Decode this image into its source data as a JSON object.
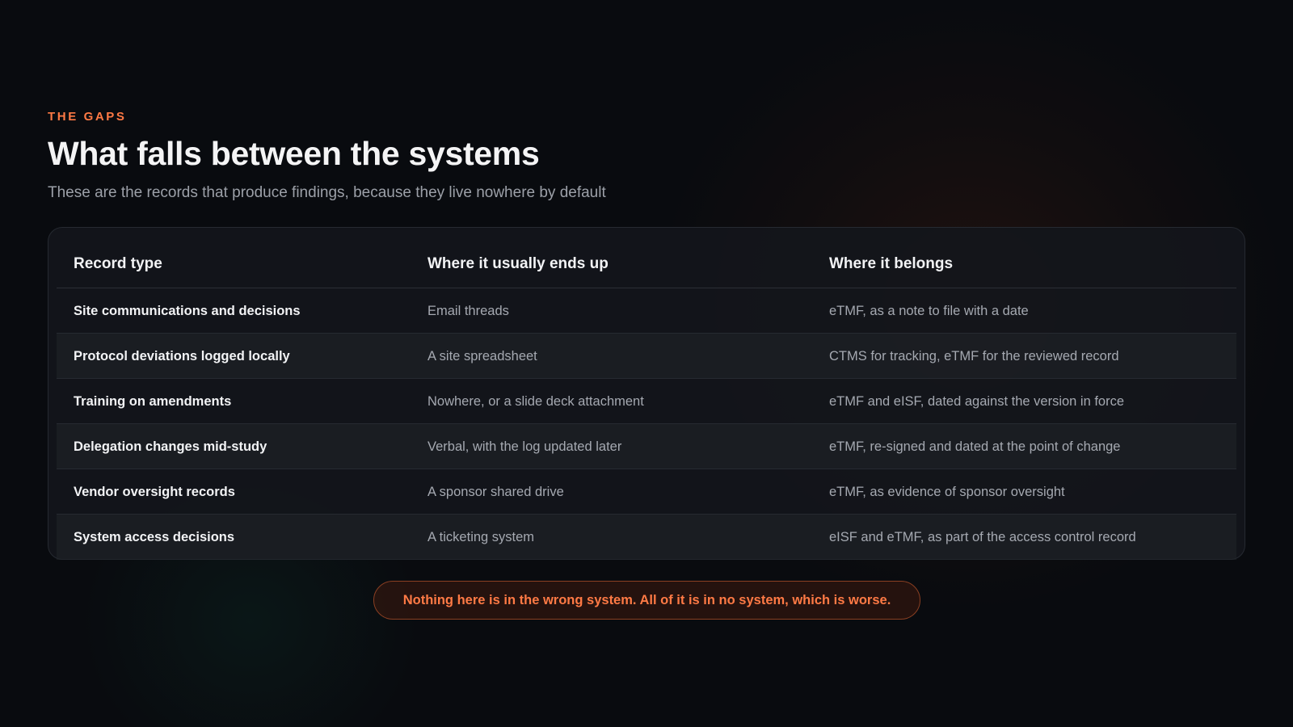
{
  "eyebrow": "THE GAPS",
  "title": "What falls between the systems",
  "subtitle": "These are the records that produce findings, because they live nowhere by default",
  "table": {
    "headers": [
      "Record type",
      "Where it usually ends up",
      "Where it belongs"
    ],
    "rows": [
      [
        "Site communications and decisions",
        "Email threads",
        "eTMF, as a note to file with a date"
      ],
      [
        "Protocol deviations logged locally",
        "A site spreadsheet",
        "CTMS for tracking, eTMF for the reviewed record"
      ],
      [
        "Training on amendments",
        "Nowhere, or a slide deck attachment",
        "eTMF and eISF, dated against the version in force"
      ],
      [
        "Delegation changes mid-study",
        "Verbal, with the log updated later",
        "eTMF, re-signed and dated at the point of change"
      ],
      [
        "Vendor oversight records",
        "A sponsor shared drive",
        "eTMF, as evidence of sponsor oversight"
      ],
      [
        "System access decisions",
        "A ticketing system",
        "eISF and eTMF, as part of the access control record"
      ]
    ]
  },
  "callout": "Nothing here is in the wrong system. All of it is in no system, which is worse.",
  "colors": {
    "accent": "#ff7a45",
    "background": "#090b0f",
    "text": "#f4f4f5",
    "muted": "#9ca0a8"
  }
}
